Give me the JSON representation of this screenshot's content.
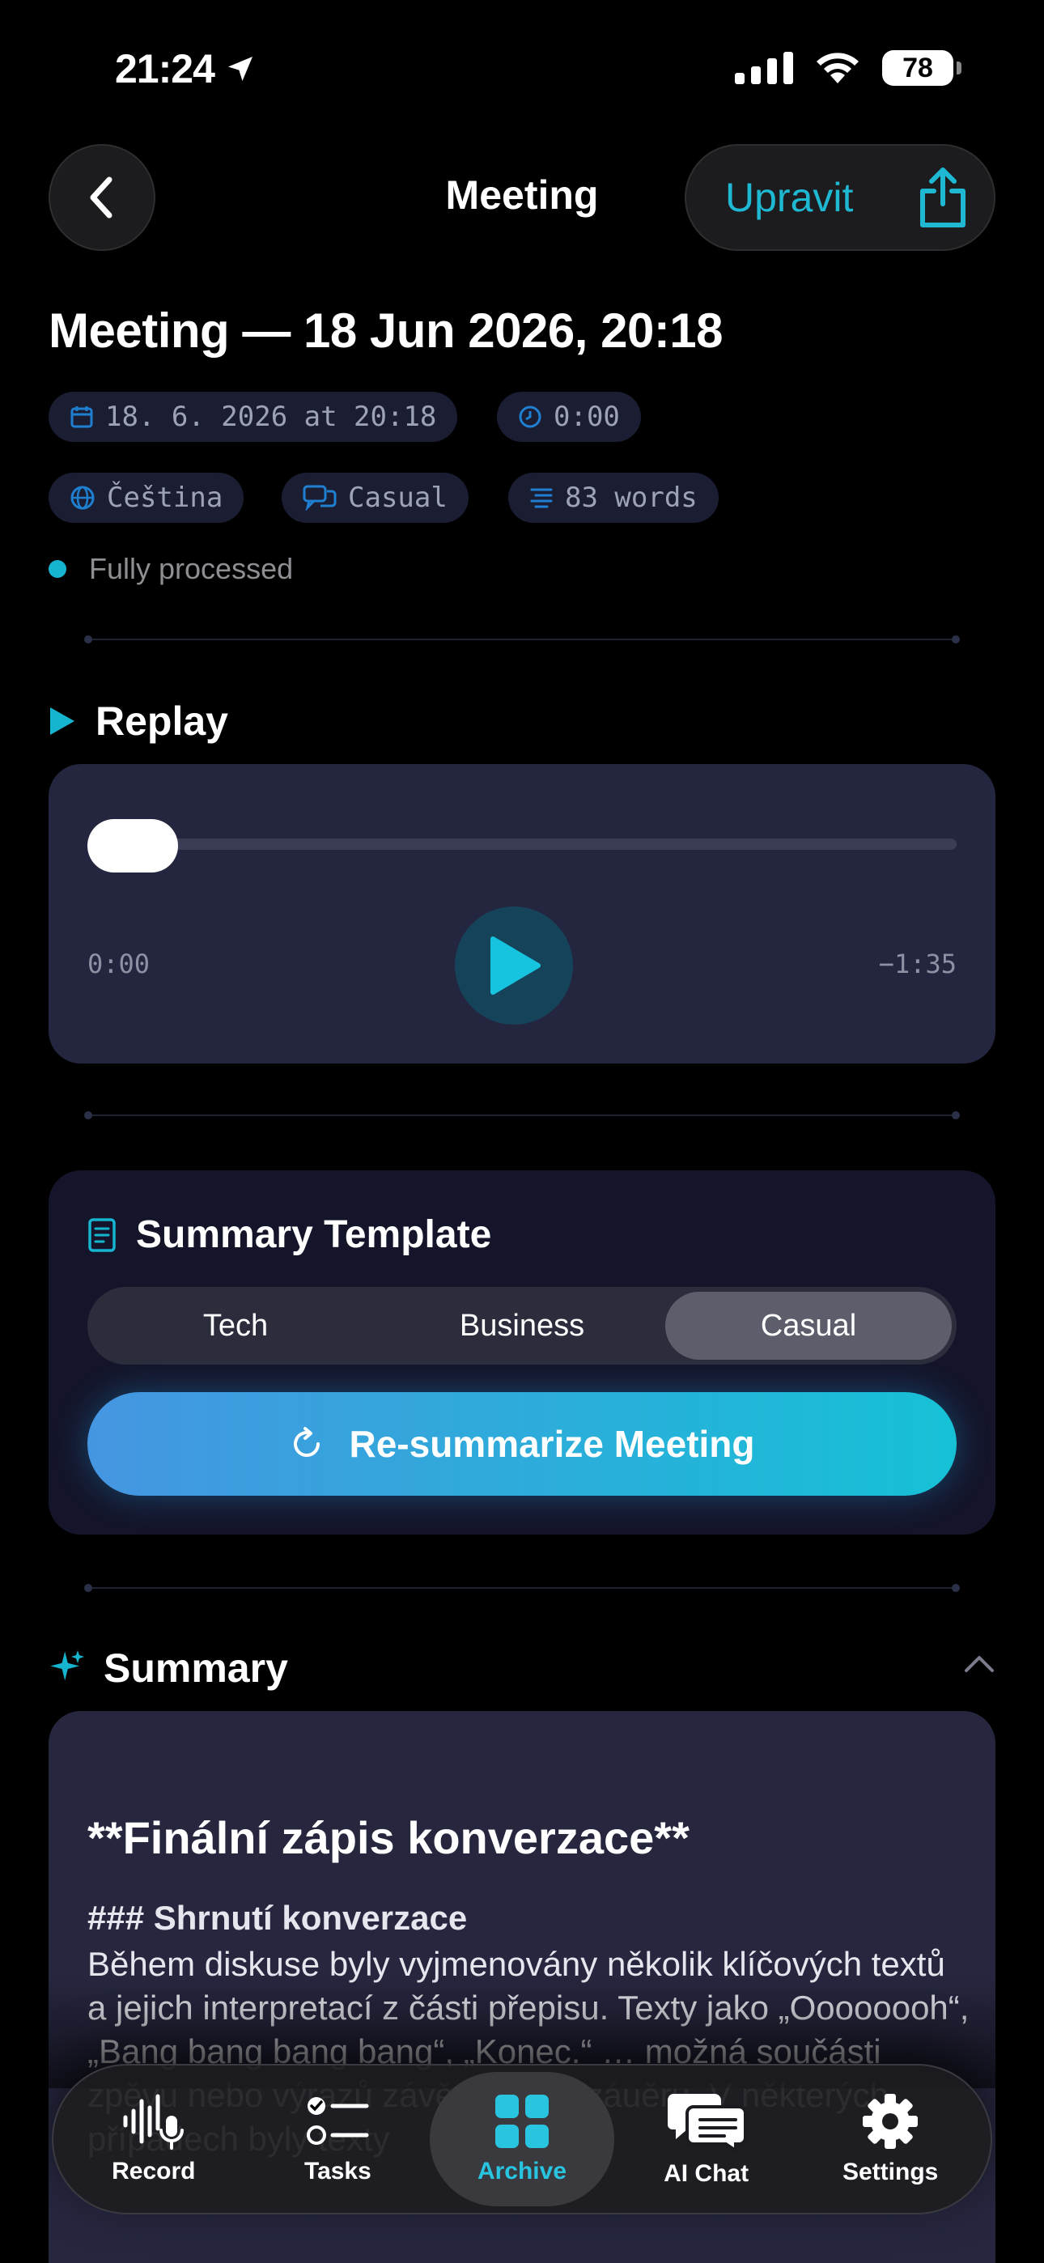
{
  "status_bar": {
    "time": "21:24",
    "battery": "78"
  },
  "nav": {
    "title": "Meeting",
    "edit_label": "Upravit"
  },
  "meeting": {
    "title": "Meeting — 18 Jun 2026, 20:18",
    "date_chip": "18. 6. 2026 at 20:18",
    "duration_chip": "0:00",
    "language_chip": "Čeština",
    "style_chip": "Casual",
    "words_chip": "83 words",
    "status": "Fully processed"
  },
  "replay": {
    "heading": "Replay",
    "elapsed": "0:00",
    "remaining": "−1:35",
    "progress": 0.0
  },
  "template": {
    "heading": "Summary Template",
    "options": [
      "Tech",
      "Business",
      "Casual"
    ],
    "selected": "Casual",
    "resummarize_label": "Re-summarize Meeting"
  },
  "summary": {
    "heading": "Summary",
    "h1": "**Finální zápis konverzace**",
    "h3": "### Shrnutí konverzace",
    "body": "Během diskuse byly vyjmenovány několik klíčových textů a jejich interpretací z části přepisu. Texty jako „Oooooooh“, „Bang bang bang bang“, „Konec.“ … možná součásti zpěvu nebo výrazů závěrečného záuěru. V některých případech byly texty"
  },
  "tabs": [
    {
      "label": "Record",
      "icon": "waveform-mic-icon"
    },
    {
      "label": "Tasks",
      "icon": "checklist-icon"
    },
    {
      "label": "Archive",
      "icon": "grid-icon",
      "active": true
    },
    {
      "label": "AI Chat",
      "icon": "chat-bubbles-icon"
    },
    {
      "label": "Settings",
      "icon": "gear-icon"
    }
  ],
  "colors": {
    "accent": "#1fb8d2",
    "card": "#24253f",
    "chip": "#1b1e33"
  }
}
